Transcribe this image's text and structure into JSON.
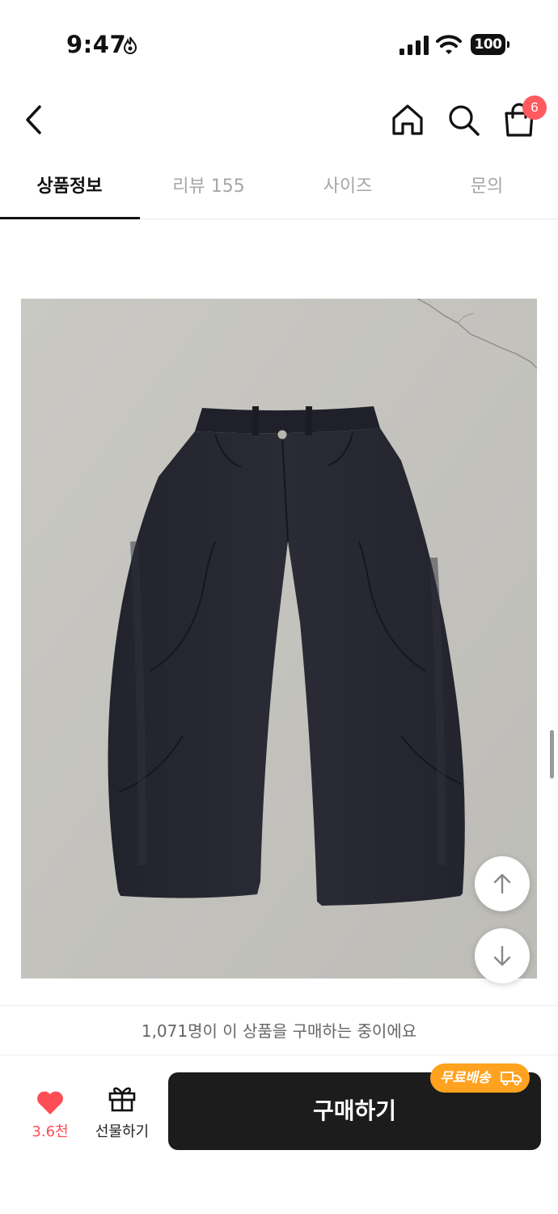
{
  "status_bar": {
    "time": "9:47",
    "battery": "100"
  },
  "header": {
    "back_icon": "chevron-left-icon",
    "home_icon": "home-icon",
    "search_icon": "search-icon",
    "cart_icon": "shopping-bag-icon",
    "cart_count": "6"
  },
  "tabs": [
    {
      "label": "상품정보",
      "active": true
    },
    {
      "label": "리뷰 155",
      "active": false
    },
    {
      "label": "사이즈",
      "active": false
    },
    {
      "label": "문의",
      "active": false
    }
  ],
  "buyer_notice": "1,071명이 이 상품을 구매하는 중이에요",
  "bottom_bar": {
    "like_count": "3.6천",
    "gift_label": "선물하기",
    "buy_label": "구매하기",
    "free_shipping_badge": "무료배송"
  },
  "colors": {
    "accent_red": "#ff4d55",
    "badge_orange": "#ffa21f",
    "buy_button": "#1c1c1c"
  }
}
